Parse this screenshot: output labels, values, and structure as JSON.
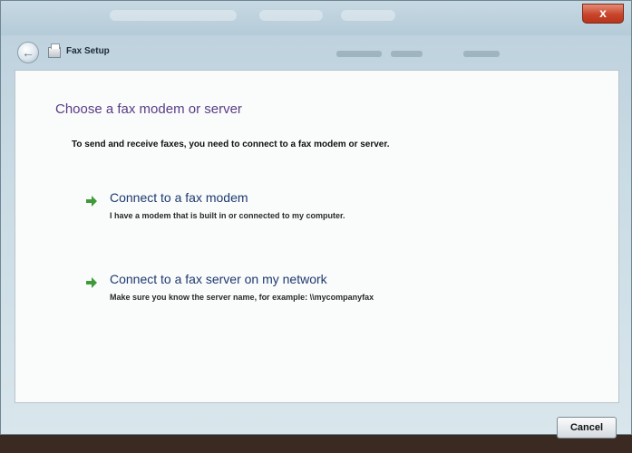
{
  "window": {
    "title": "Fax Setup",
    "close_label": "x"
  },
  "page": {
    "heading": "Choose a fax modem or server",
    "intro": "To send and receive faxes, you need to connect to a fax modem or server."
  },
  "options": [
    {
      "title": "Connect to a fax modem",
      "description": "I have a modem that is built in or connected to my computer.",
      "icon": "green-arrow-icon"
    },
    {
      "title": "Connect to a fax server on my network",
      "description": "Make sure you know the server name, for example: \\\\mycompanyfax",
      "icon": "green-arrow-icon"
    }
  ],
  "footer": {
    "cancel_label": "Cancel"
  },
  "colors": {
    "heading": "#5a3c86",
    "link": "#1d3a70",
    "arrow": "#3f9a3a",
    "close": "#c8452a"
  }
}
